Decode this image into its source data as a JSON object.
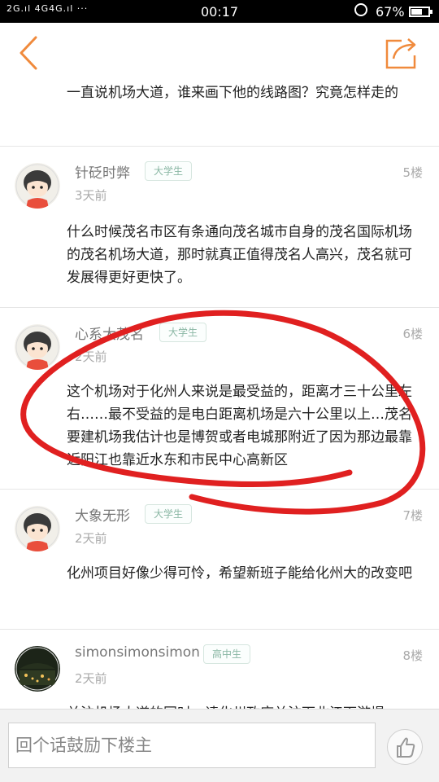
{
  "status_bar": {
    "signal": "2G.ıl 4G4G.ıl ···",
    "time": "00:17",
    "alarm_icon": "alarm-icon",
    "battery_percent": "67%",
    "battery_level": 0.67
  },
  "nav": {
    "back_icon": "back-arrow-icon",
    "share_icon": "share-icon",
    "accent_color": "#f08a3c"
  },
  "top_post": {
    "text": "一直说机场大道，谁来画下他的线路图？究竟怎样走的"
  },
  "comments": [
    {
      "username": "针砭时弊",
      "badge": "大学生",
      "floor": "5楼",
      "time": "3天前",
      "text": "什么时候茂名市区有条通向茂名城市自身的茂名国际机场的茂名机场大道，那时就真正值得茂名人高兴，茂名就可发展得更好更快了。"
    },
    {
      "username": "心系大茂名",
      "badge": "大学生",
      "floor": "6楼",
      "time": "2天前",
      "text": "这个机场对于化州人来说是最受益的，距离才三十公里左右……最不受益的是电白距离机场是六十公里以上…茂名要建机场我估计也是博贺或者电城那附近了因为那边最靠近阳江也靠近水东和市民中心高新区"
    },
    {
      "username": "大象无形",
      "badge": "大学生",
      "floor": "7楼",
      "time": "2天前",
      "text": "化州项目好像少得可怜，希望新班子能给化州大的改变吧"
    },
    {
      "username": "simonsimonsimon",
      "badge": "高中生",
      "floor": "8楼",
      "time": "2天前",
      "text": "关注机场大道的同时，请化州政府关注下北江下游堤"
    }
  ],
  "bottom_bar": {
    "reply_placeholder": "回个话鼓励下楼主",
    "like_icon": "thumbs-up-icon"
  },
  "annotation_color": "#e02020"
}
